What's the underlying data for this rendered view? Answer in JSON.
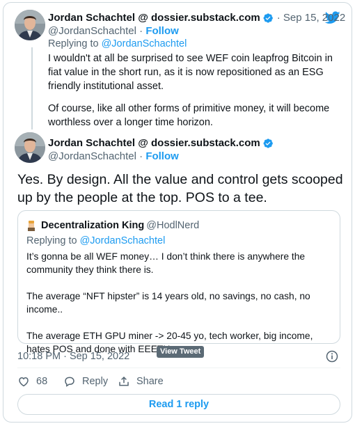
{
  "colors": {
    "accent": "#1d9bf0",
    "muted": "#536471",
    "text": "#0f1419",
    "border": "#cfd9de"
  },
  "parent_tweet": {
    "display_name": "Jordan Schachtel @ dossier.substack.com",
    "date": "· Sep 15, 2022",
    "handle": "@JordanSchachtel",
    "separator": " · ",
    "follow_label": "Follow",
    "replying_prefix": "Replying to ",
    "replying_to": "@JordanSchachtel",
    "paragraph_1": "I wouldn't at all be surprised to see WEF coin leapfrog Bitcoin in fiat value in the short run, as it is now repositioned as an ESG friendly institutional asset.",
    "paragraph_2": "Of course, like all other forms of primitive money, it will become worthless over a longer time horizon."
  },
  "main_tweet": {
    "display_name": "Jordan Schachtel @ dossier.substack.com",
    "handle": "@JordanSchachtel",
    "separator": " · ",
    "follow_label": "Follow",
    "text": "Yes. By design. All the value and control gets scooped up by the people at the top. POS to a tee.",
    "timestamp": "10:18 PM · Sep 15, 2022"
  },
  "quoted_tweet": {
    "display_name": "Decentralization King",
    "handle": "@HodlNerd",
    "replying_prefix": "Replying to ",
    "replying_to": "@JordanSchachtel",
    "paragraph_1": "It’s gonna be all WEF money… I don’t think there is anywhere the community they think there is.",
    "paragraph_2": "The average “NFT hipster” is 14 years old, no savings, no cash, no income..",
    "paragraph_3": "The average ETH GPU miner -> 20-45 yo, tech worker, big income, hates POS and done with EEETH."
  },
  "tooltip": "View Tweet",
  "actions": {
    "like_count": "68",
    "reply_label": "Reply",
    "share_label": "Share"
  },
  "read_replies_label": "Read 1 reply",
  "icons": [
    "twitter-bird-icon",
    "verified-badge-icon",
    "info-icon",
    "heart-icon",
    "reply-bubble-icon",
    "share-icon"
  ]
}
